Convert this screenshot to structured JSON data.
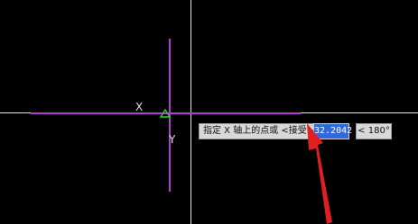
{
  "canvas": {
    "background": "#000000",
    "crosshair_color": "#e8e8e8",
    "construction_line_color": "#b23bd6"
  },
  "axes": {
    "x_label": "X",
    "y_label": "Y"
  },
  "prompt": {
    "text": "指定 X 轴上的点或 <接受>:",
    "input_value": "32.2042",
    "angle_text": "< 180°"
  },
  "annotation": {
    "arrow_color": "#e02020",
    "icon": "red-arrow-icon"
  },
  "ucs_marker": {
    "icon": "triangle-icon",
    "color": "#2bd32b"
  }
}
